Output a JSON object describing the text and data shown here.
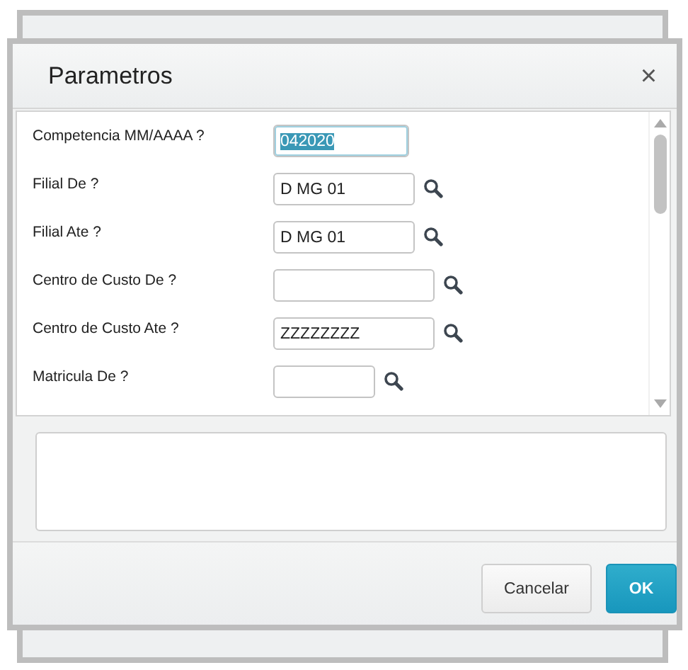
{
  "dialog": {
    "title": "Parametros",
    "close": "×"
  },
  "parameters": [
    {
      "label": "Competencia MM/AAAA ?",
      "value": "042020",
      "lookup": false,
      "highlighted": true
    },
    {
      "label": "Filial De ?",
      "value": "D MG 01",
      "lookup": true,
      "highlighted": false
    },
    {
      "label": "Filial Ate ?",
      "value": "D MG 01",
      "lookup": true,
      "highlighted": false
    },
    {
      "label": "Centro de Custo De ?",
      "lookup": true,
      "highlighted": false
    },
    {
      "label": "Centro de Custo Ate ?",
      "value": "ZZZZZZZZ",
      "lookup": true,
      "highlighted": false
    },
    {
      "label": "Matricula De ?",
      "lookup": true,
      "highlighted": false
    }
  ],
  "buttons": [
    {
      "label": "Cancelar",
      "kind": "secondary"
    },
    {
      "label": "OK",
      "kind": "primary"
    }
  ]
}
